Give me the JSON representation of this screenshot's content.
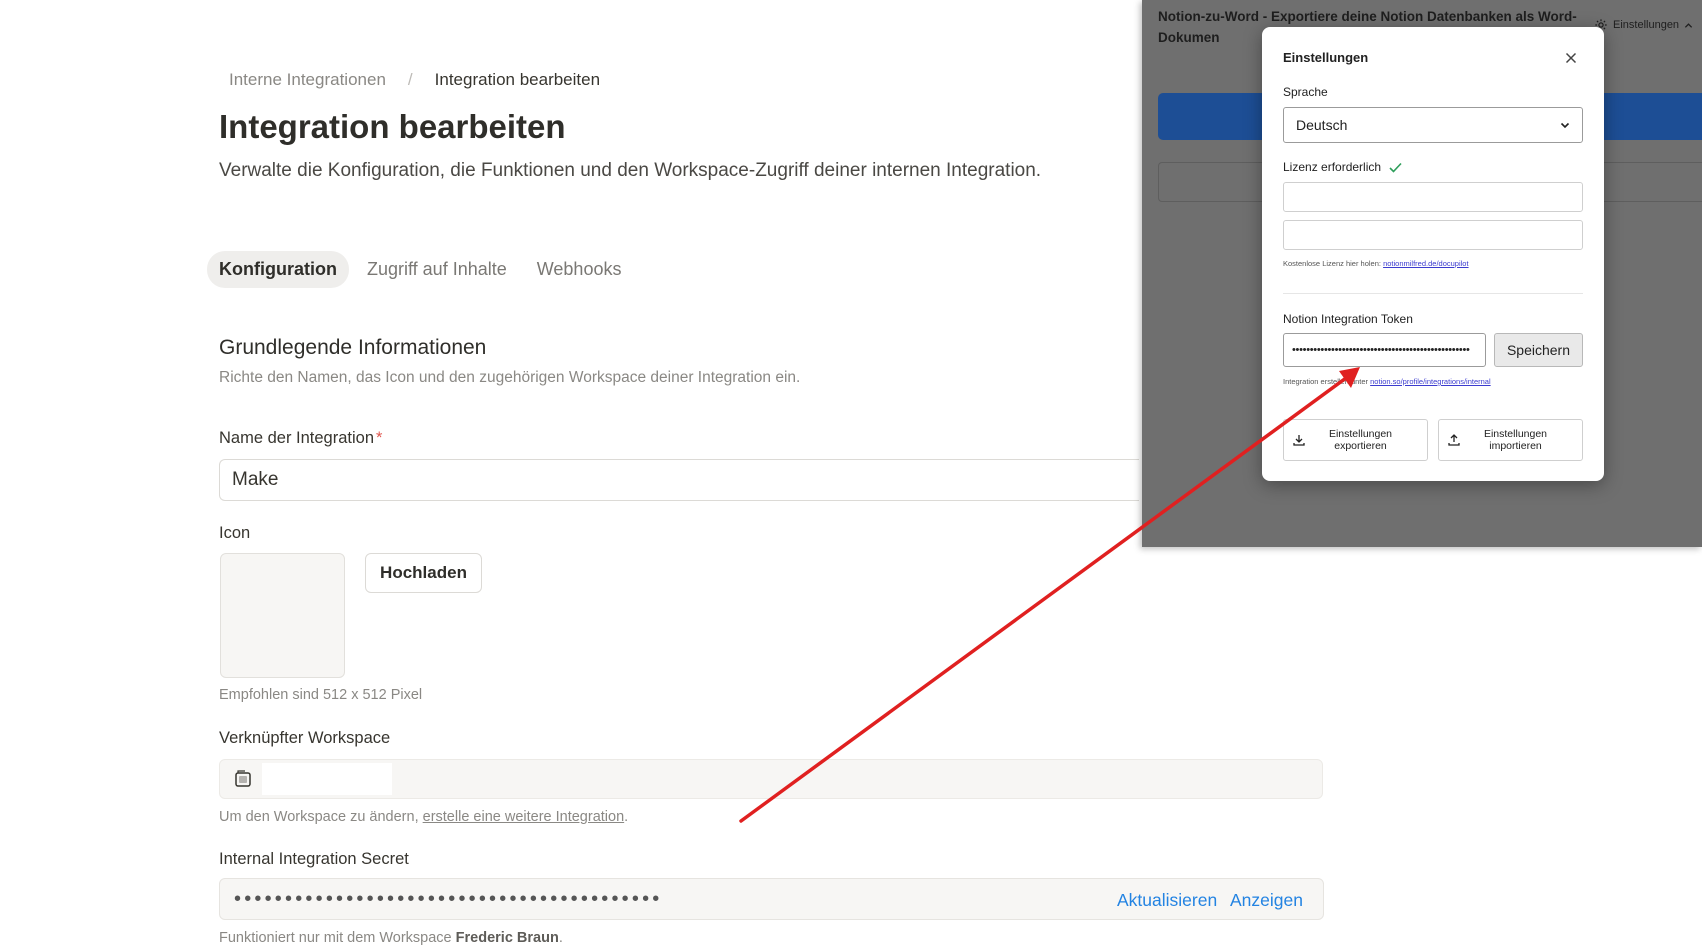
{
  "breadcrumb": {
    "parent": "Interne Integrationen",
    "separator": "/",
    "current": "Integration bearbeiten"
  },
  "page": {
    "title": "Integration bearbeiten",
    "description": "Verwalte die Konfiguration, die Funktionen und den Workspace-Zugriff deiner internen Integration."
  },
  "tabs": [
    {
      "label": "Konfiguration",
      "active": true
    },
    {
      "label": "Zugriff auf Inhalte",
      "active": false
    },
    {
      "label": "Webhooks",
      "active": false
    }
  ],
  "basic_info": {
    "title": "Grundlegende Informationen",
    "description": "Richte den Namen, das Icon und den zugehörigen Workspace deiner Integration ein."
  },
  "name_field": {
    "label": "Name der Integration",
    "required_mark": "*",
    "value": "Make"
  },
  "icon_field": {
    "label": "Icon",
    "upload_label": "Hochladen",
    "hint": "Empfohlen sind 512 x 512 Pixel"
  },
  "workspace_field": {
    "label": "Verknüpfter Workspace",
    "hint_prefix": "Um den Workspace zu ändern, ",
    "hint_link": "erstelle eine weitere Integration",
    "hint_suffix": "."
  },
  "secret_field": {
    "label": "Internal Integration Secret",
    "masked_value": "••••••••••••••••••••••••••••••••••••••••••",
    "refresh_label": "Aktualisieren",
    "show_label": "Anzeigen",
    "hint_prefix": "Funktioniert nur mit dem Workspace ",
    "hint_workspace": "Frederic Braun",
    "hint_suffix": "."
  },
  "extension": {
    "title": "Notion-zu-Word - Exportiere deine Notion Datenbanken als Word-Dokumen",
    "settings_label": "Einstellungen",
    "settings_icon": "gear-icon",
    "background_color": "#6f6f6f",
    "primary_color": "#1d4e95"
  },
  "settings_modal": {
    "title": "Einstellungen",
    "language_label": "Sprache",
    "language_value": "Deutsch",
    "license_label": "Lizenz erforderlich",
    "license_hint_prefix": "Kostenlose Lizenz hier holen: ",
    "license_hint_link": "notionmilfred.de/docupilot",
    "token_label": "Notion Integration Token",
    "token_value": "••••••••••••••••••••••••••••••••••••••••••••••••••",
    "save_label": "Speichern",
    "token_hint_prefix": "Integration erstellen unter ",
    "token_hint_link": "notion.so/profile/integrations/internal",
    "export_label": "Einstellungen exportieren",
    "import_label": "Einstellungen importieren",
    "check_color": "#2e9e5b"
  },
  "annotation": {
    "arrow_color": "#e02020"
  }
}
